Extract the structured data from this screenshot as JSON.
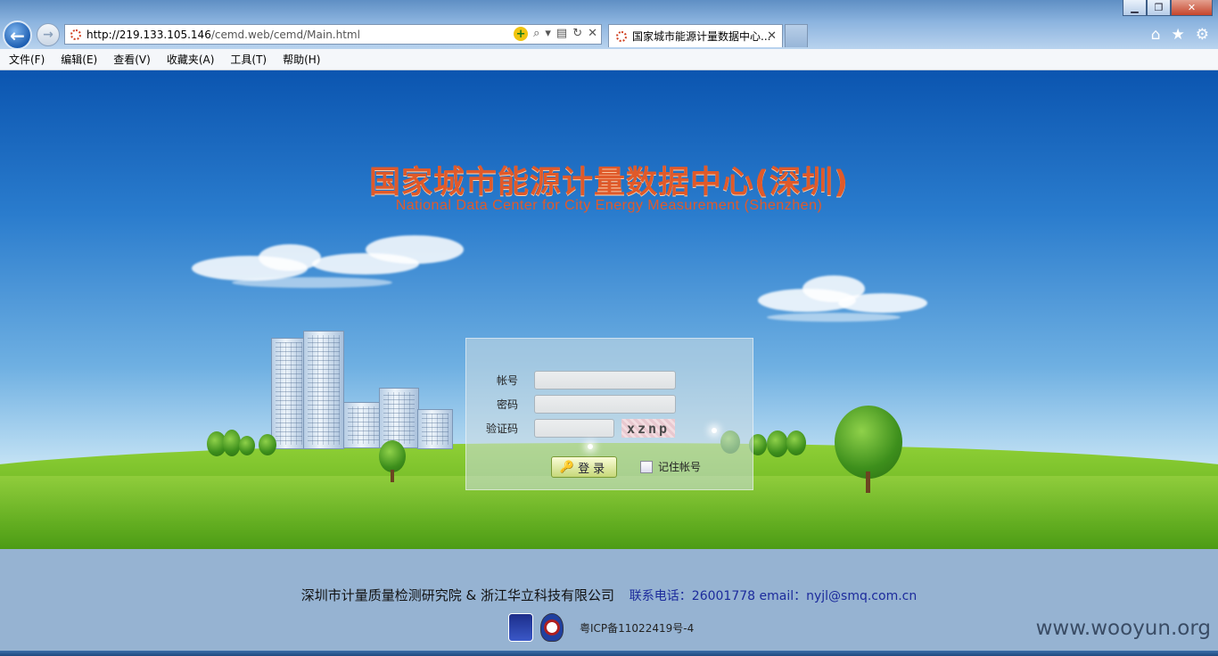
{
  "browser": {
    "window_buttons": [
      "▁",
      "❐",
      "✕"
    ],
    "address": {
      "host": "http://219.133.105.146",
      "path": "/cemd.web/cemd/Main.html"
    },
    "tab_title": "国家城市能源计量数据中心...",
    "menu": [
      "文件(F)",
      "编辑(E)",
      "查看(V)",
      "收藏夹(A)",
      "工具(T)",
      "帮助(H)"
    ],
    "icons": [
      "home-icon",
      "star-icon",
      "gear-icon"
    ]
  },
  "page": {
    "title_cn": "国家城市能源计量数据中心(深圳)",
    "title_en": "National Data Center for City Energy Measurement (Shenzhen)",
    "login": {
      "account_label": "帐号",
      "password_label": "密码",
      "captcha_label": "验证码",
      "captcha_text": "xznp",
      "login_button": "登录",
      "remember_label": "记住帐号"
    }
  },
  "footer": {
    "org": "深圳市计量质量检测研究院 & 浙江华立科技有限公司",
    "contact": "联系电话：26001778 email：nyjl@smq.com.cn",
    "icp": "粤ICP备11022419号-4",
    "watermark": "www.wooyun.org"
  }
}
